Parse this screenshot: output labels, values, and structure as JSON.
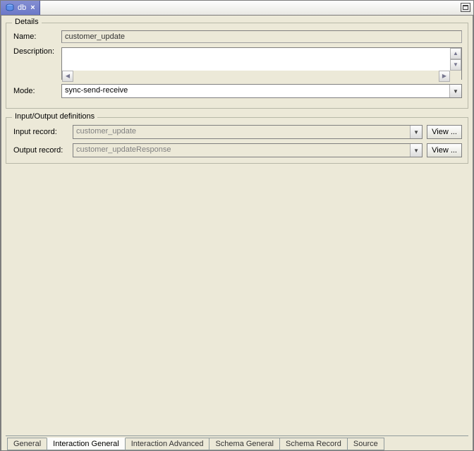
{
  "tab": {
    "title": "db"
  },
  "details": {
    "legend": "Details",
    "name_label": "Name:",
    "name_value": "customer_update",
    "description_label": "Description:",
    "description_value": "",
    "mode_label": "Mode:",
    "mode_value": "sync-send-receive"
  },
  "io": {
    "legend": "Input/Output definitions",
    "input_label": "Input record:",
    "input_value": "customer_update",
    "output_label": "Output record:",
    "output_value": "customer_updateResponse",
    "view_button": "View ..."
  },
  "bottom_tabs": {
    "items": [
      "General",
      "Interaction General",
      "Interaction Advanced",
      "Schema General",
      "Schema Record",
      "Source"
    ],
    "active_index": 1
  }
}
